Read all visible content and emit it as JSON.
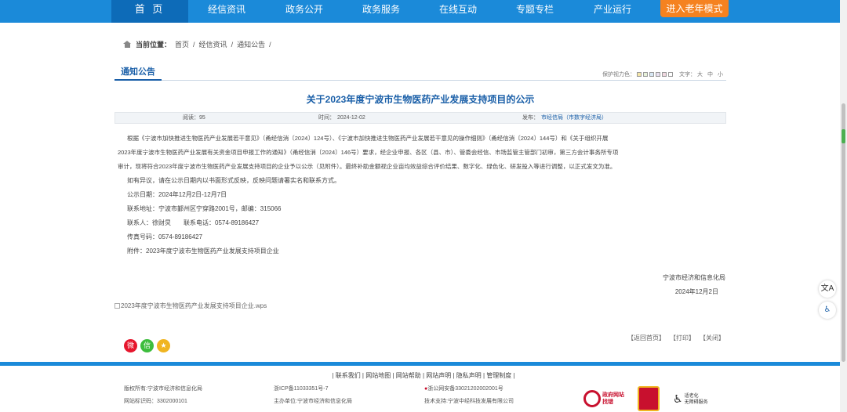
{
  "nav": {
    "home": "首 页",
    "items": [
      "经信资讯",
      "政务公开",
      "政务服务",
      "在线互动",
      "专题专栏",
      "产业运行"
    ],
    "elder_mode": "进入老年模式"
  },
  "breadcrumb": {
    "label": "当前位置：",
    "items": [
      "首页",
      "/",
      "经信资讯",
      "/",
      "通知公告",
      "/"
    ]
  },
  "section": {
    "title": "通知公告",
    "eye_label": "保护视力色：",
    "swatches": [
      "#f5e6a8",
      "#e6f0d8",
      "#d8e8f5",
      "#e8e0f0",
      "#f0d8e0",
      "#ffffff"
    ],
    "font_label": "文字：",
    "font_sizes": [
      "大",
      "中",
      "小"
    ]
  },
  "article": {
    "title": "关于2023年度宁波市生物医药产业发展支持项目的公示",
    "meta": {
      "views": "阅读：95",
      "time_label": "时间：",
      "time": "2024-12-02",
      "source_label": "发布：",
      "source": "市经信局（市数字经济局）"
    },
    "paragraph_lines": [
      "根据《宁波市加快推进生物医药产业发展若干意见》（甬经信消〔2024〕124号）、《宁波市加快推进生物医药产业发展若干意见的操作细则》（甬经信消〔2024〕144号）和《关于组织开展",
      "2023年度宁波市生物医药产业发展有关资金项目申报工作的通知》（甬经信消〔2024〕146号）要求，经企业申报、各区（县、市）、管委会经信、市场监管主管部门初审，第三方会计事务所专项",
      "审计，现将符合2023年度宁波市生物医药产业发展支持项目的企业予以公示（见附件）。最终补助金额视企业亩均效益综合评价结果、数字化、绿色化、研发投入等进行调整，以正式发文为准。"
    ],
    "lines": [
      "如有异议，请在公示日期内以书面形式反映，反映问题请署实名和联系方式。",
      "公示日期：2024年12月2日-12月7日",
      "联系地址：宁波市鄞州区宁穿路2001号，邮编：315066",
      "联系人：徐财炅　　联系电话：0574-89186427",
      "传真号码：0574-89186427",
      "附件：2023年度宁波市生物医药产业发展支持项目企业"
    ],
    "signature": "宁波市经济和信息化局",
    "date": "2024年12月2日",
    "attachment": "2023年度宁波市生物医药产业发展支持项目企业.wps",
    "actions": [
      "【返回首页】",
      "【打印】",
      "【关闭】"
    ]
  },
  "share": [
    {
      "icon": "weibo-icon",
      "symbol": "微",
      "color": "#e6162d"
    },
    {
      "icon": "wechat-icon",
      "symbol": "信",
      "color": "#3dbd3d"
    },
    {
      "icon": "favorite-icon",
      "symbol": "★",
      "color": "#f0b521"
    }
  ],
  "footer": {
    "links": "| 联系我们 | 网站地图 | 网站帮助 | 网站声明 | 隐私声明 | 管理制度 |",
    "copyright": "版权所有:宁波市经济和信息化局",
    "site_code": "网站标识码：3302000101",
    "icp": "浙ICP备11033351号-7",
    "sponsor": "主办单位:宁波市经济和信息化局",
    "police": "浙公网安备33021202002001号",
    "tech": "技术支持:宁波中经科技发展有限公司",
    "badge1_line1": "政府网站",
    "badge1_line2": "找错",
    "badge3_line1": "适老化",
    "badge3_line2": "无障碍服务"
  },
  "side": {
    "icon1": "文A",
    "icon2": "♿"
  }
}
